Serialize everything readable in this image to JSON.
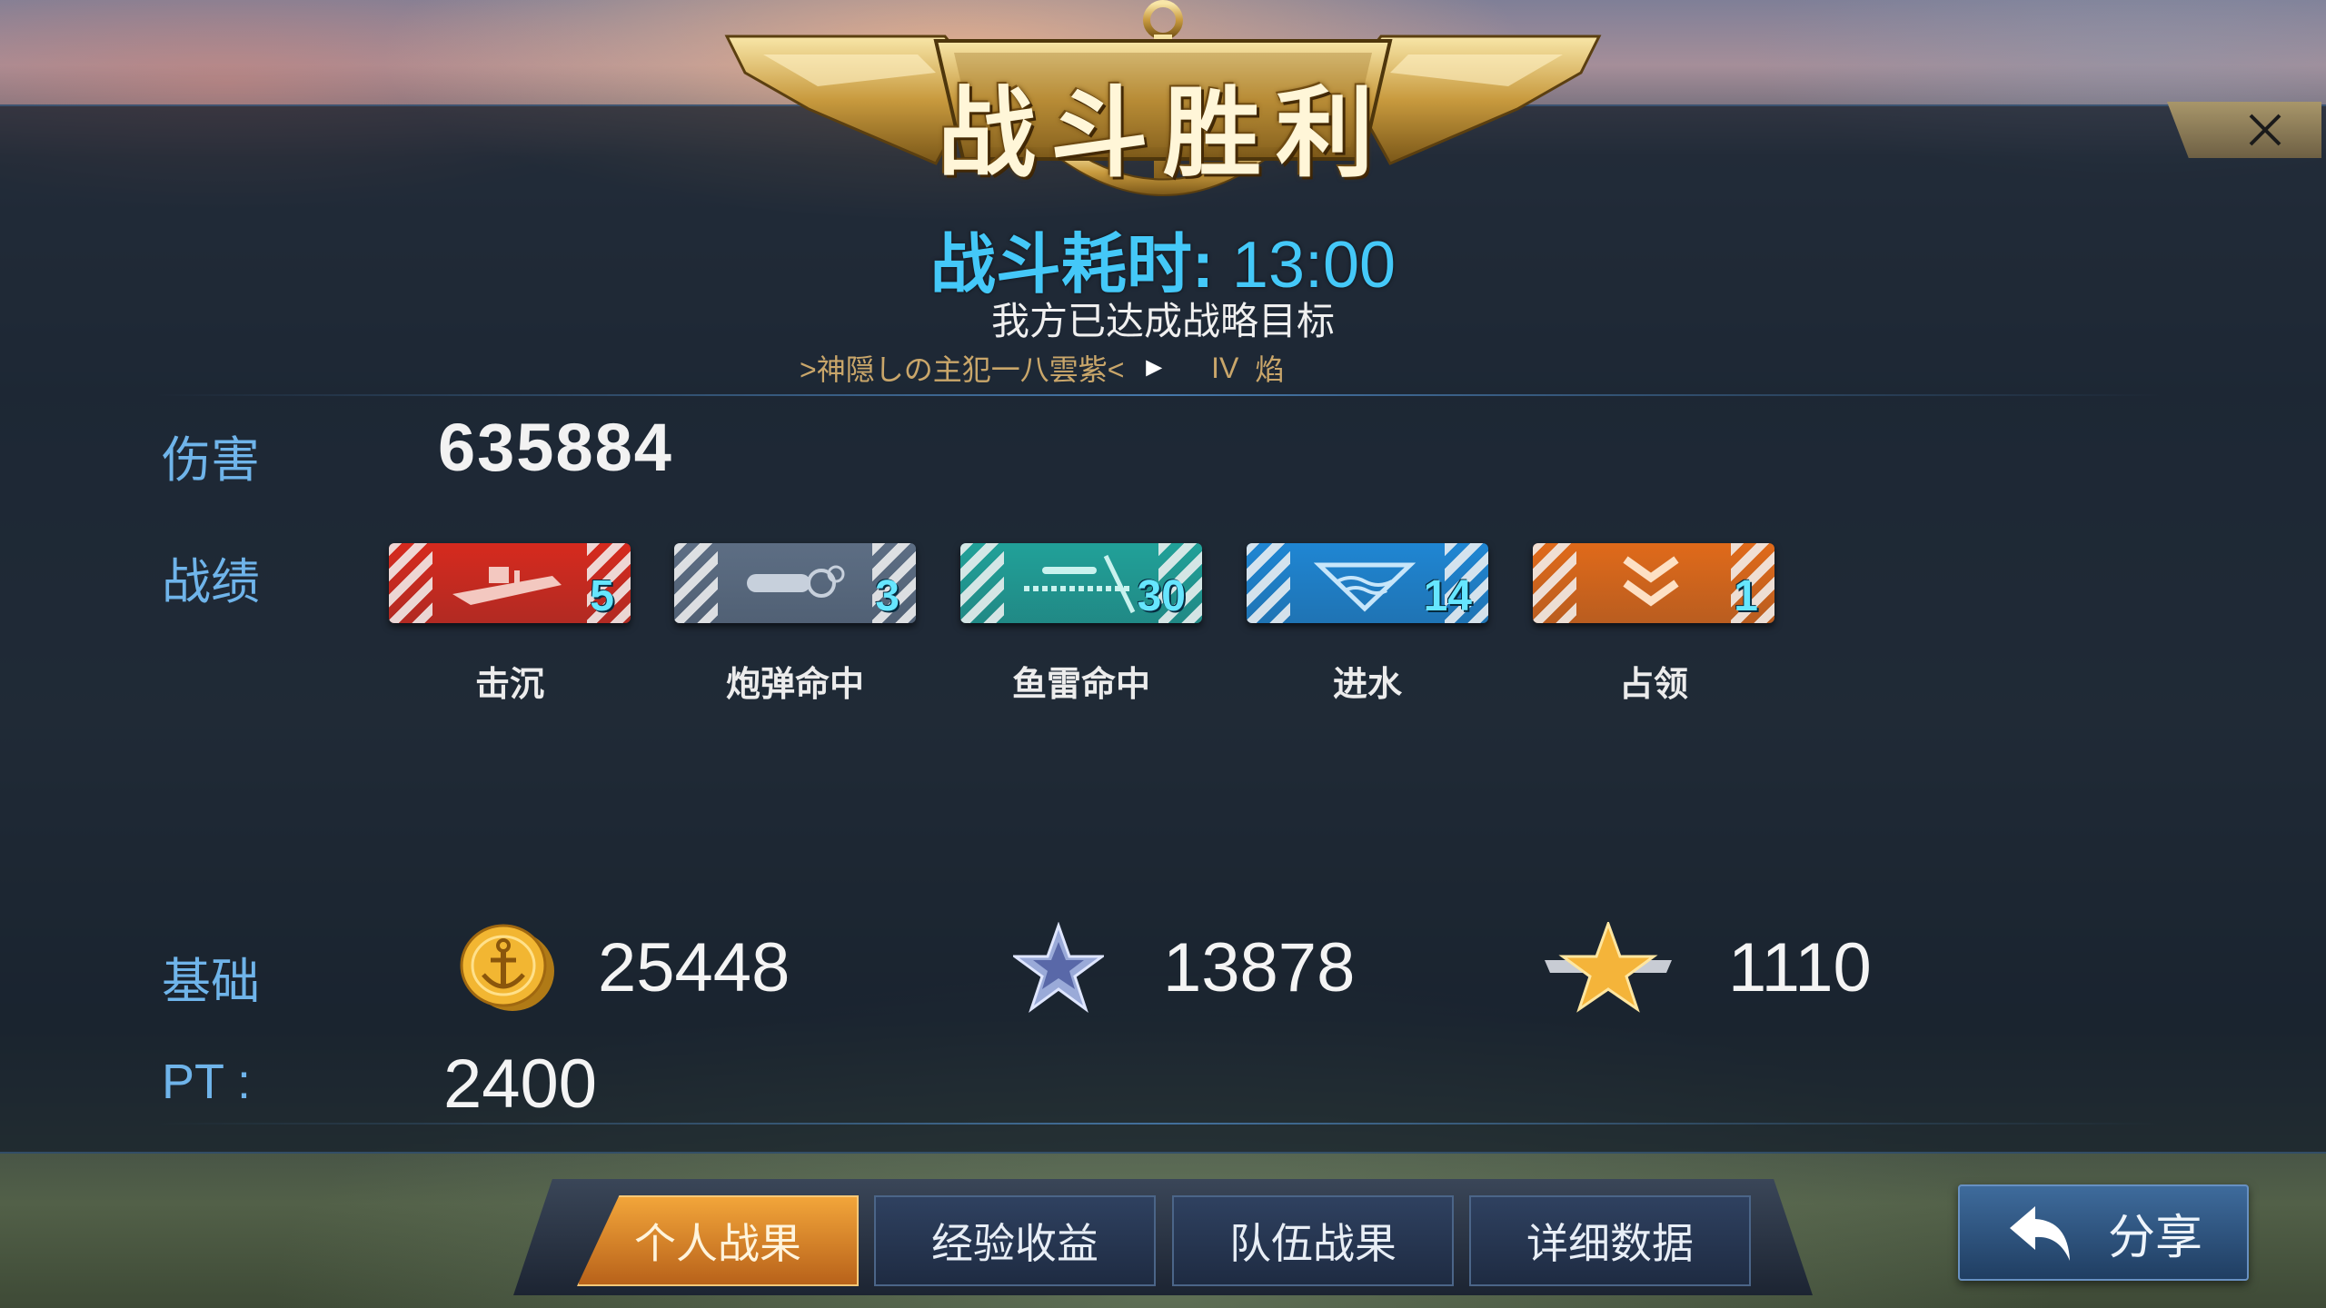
{
  "header": {
    "title": "战斗胜利"
  },
  "battle": {
    "duration_label": "战斗耗时:",
    "duration_value": "13:00",
    "status": "我方已达成战略目标",
    "player_name": ">神隠しの主犯一八雲紫<",
    "player_rank": "IV",
    "player_ship": "焰"
  },
  "stats": {
    "damage_label": "伤害",
    "damage_value": "635884",
    "record_label": "战绩",
    "badges": [
      {
        "caption": "击沉",
        "count": "5",
        "color": "#d62a1e",
        "icon": "ship-icon"
      },
      {
        "caption": "炮弹命中",
        "count": "3",
        "color": "#5d6e84",
        "icon": "shell-icon"
      },
      {
        "caption": "鱼雷命中",
        "count": "30",
        "color": "#21a199",
        "icon": "torpedo-icon"
      },
      {
        "caption": "进水",
        "count": "14",
        "color": "#1f86d3",
        "icon": "flood-icon"
      },
      {
        "caption": "占领",
        "count": "1",
        "color": "#e06a1a",
        "icon": "capture-icon"
      }
    ]
  },
  "rewards": {
    "base_label": "基础",
    "coins": "25448",
    "experience": "13878",
    "rank_points": "1110",
    "pt_label": "PT :",
    "pt_value": "2400"
  },
  "tabs": [
    {
      "label": "个人战果",
      "active": true
    },
    {
      "label": "经验收益",
      "active": false
    },
    {
      "label": "队伍战果",
      "active": false
    },
    {
      "label": "详细数据",
      "active": false
    }
  ],
  "share": {
    "label": "分享"
  }
}
